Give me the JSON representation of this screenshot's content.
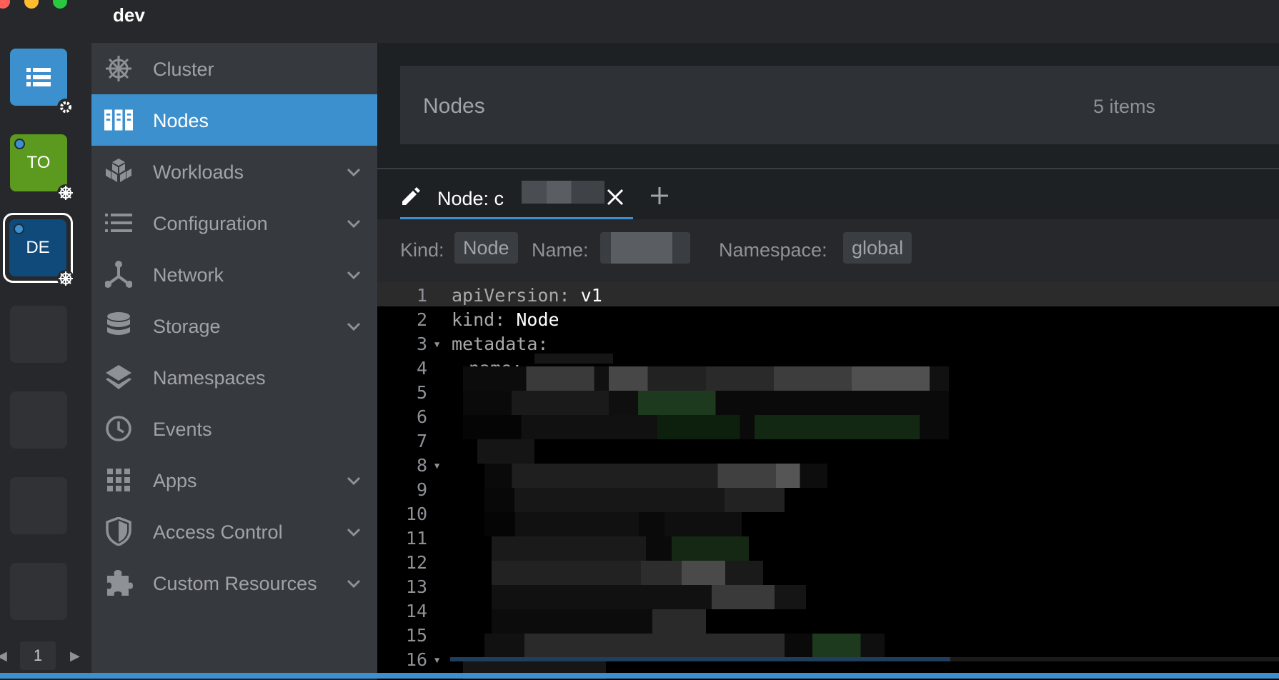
{
  "rail": {
    "clusters": [
      {
        "label": "",
        "icon": "catalog-list-icon",
        "badge": "gear-icon"
      },
      {
        "label": "TO",
        "color": "#5b9a1e",
        "badge": "helm-icon"
      },
      {
        "label": "DE",
        "color": "#0f4a7a",
        "badge": "helm-icon",
        "active": true
      }
    ],
    "page": "1"
  },
  "header": {
    "cluster_name": "dev"
  },
  "sidebar": {
    "items": [
      {
        "label": "Cluster",
        "icon": "helm-icon"
      },
      {
        "label": "Nodes",
        "icon": "nodes-icon",
        "active": true
      },
      {
        "label": "Workloads",
        "icon": "cubes-icon",
        "expandable": true
      },
      {
        "label": "Configuration",
        "icon": "list-icon",
        "expandable": true
      },
      {
        "label": "Network",
        "icon": "network-icon",
        "expandable": true
      },
      {
        "label": "Storage",
        "icon": "database-icon",
        "expandable": true
      },
      {
        "label": "Namespaces",
        "icon": "layers-icon"
      },
      {
        "label": "Events",
        "icon": "clock-icon"
      },
      {
        "label": "Apps",
        "icon": "apps-grid-icon",
        "expandable": true
      },
      {
        "label": "Access Control",
        "icon": "shield-icon",
        "expandable": true
      },
      {
        "label": "Custom Resources",
        "icon": "puzzle-icon",
        "expandable": true
      }
    ]
  },
  "main": {
    "title": "Nodes",
    "count": "5 items"
  },
  "dock": {
    "tab_label": "Node: c",
    "info": {
      "kind_label": "Kind:",
      "kind_value": "Node",
      "name_label": "Name:",
      "namespace_label": "Namespace:",
      "namespace_value": "global"
    },
    "editor": {
      "line_numbers": [
        "1",
        "2",
        "3",
        "4",
        "5",
        "6",
        "7",
        "8",
        "9",
        "10",
        "11",
        "12",
        "13",
        "14",
        "15",
        "16"
      ],
      "line1_key": "apiVersion",
      "line1_value": "v1",
      "line2_key": "kind",
      "line2_value": "Node",
      "line3_key": "metadata",
      "line4_key": "name",
      "colon": ":"
    }
  },
  "colors": {
    "accent": "#3d90ce",
    "sidebar_bg": "#36393e",
    "main_bg": "#1e2124",
    "editor_bg": "#000000"
  }
}
